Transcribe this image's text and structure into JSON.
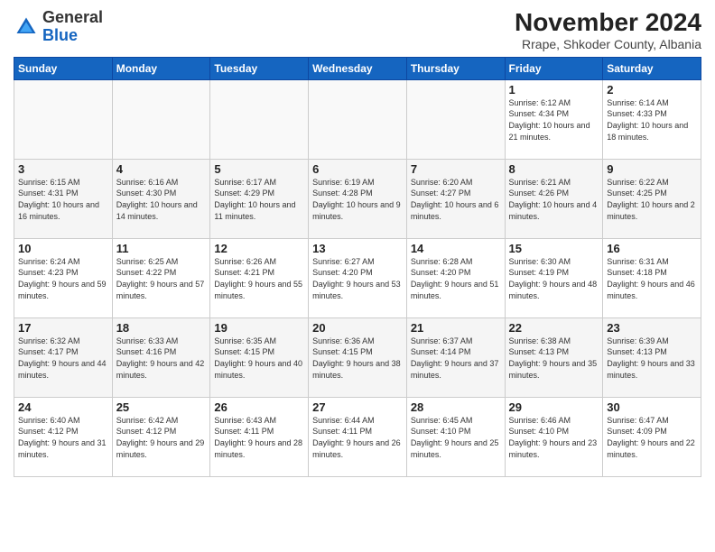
{
  "logo": {
    "general": "General",
    "blue": "Blue"
  },
  "title": {
    "month_year": "November 2024",
    "location": "Rrape, Shkoder County, Albania"
  },
  "weekdays": [
    "Sunday",
    "Monday",
    "Tuesday",
    "Wednesday",
    "Thursday",
    "Friday",
    "Saturday"
  ],
  "weeks": [
    [
      {
        "day": "",
        "info": ""
      },
      {
        "day": "",
        "info": ""
      },
      {
        "day": "",
        "info": ""
      },
      {
        "day": "",
        "info": ""
      },
      {
        "day": "",
        "info": ""
      },
      {
        "day": "1",
        "info": "Sunrise: 6:12 AM\nSunset: 4:34 PM\nDaylight: 10 hours and 21 minutes."
      },
      {
        "day": "2",
        "info": "Sunrise: 6:14 AM\nSunset: 4:33 PM\nDaylight: 10 hours and 18 minutes."
      }
    ],
    [
      {
        "day": "3",
        "info": "Sunrise: 6:15 AM\nSunset: 4:31 PM\nDaylight: 10 hours and 16 minutes."
      },
      {
        "day": "4",
        "info": "Sunrise: 6:16 AM\nSunset: 4:30 PM\nDaylight: 10 hours and 14 minutes."
      },
      {
        "day": "5",
        "info": "Sunrise: 6:17 AM\nSunset: 4:29 PM\nDaylight: 10 hours and 11 minutes."
      },
      {
        "day": "6",
        "info": "Sunrise: 6:19 AM\nSunset: 4:28 PM\nDaylight: 10 hours and 9 minutes."
      },
      {
        "day": "7",
        "info": "Sunrise: 6:20 AM\nSunset: 4:27 PM\nDaylight: 10 hours and 6 minutes."
      },
      {
        "day": "8",
        "info": "Sunrise: 6:21 AM\nSunset: 4:26 PM\nDaylight: 10 hours and 4 minutes."
      },
      {
        "day": "9",
        "info": "Sunrise: 6:22 AM\nSunset: 4:25 PM\nDaylight: 10 hours and 2 minutes."
      }
    ],
    [
      {
        "day": "10",
        "info": "Sunrise: 6:24 AM\nSunset: 4:23 PM\nDaylight: 9 hours and 59 minutes."
      },
      {
        "day": "11",
        "info": "Sunrise: 6:25 AM\nSunset: 4:22 PM\nDaylight: 9 hours and 57 minutes."
      },
      {
        "day": "12",
        "info": "Sunrise: 6:26 AM\nSunset: 4:21 PM\nDaylight: 9 hours and 55 minutes."
      },
      {
        "day": "13",
        "info": "Sunrise: 6:27 AM\nSunset: 4:20 PM\nDaylight: 9 hours and 53 minutes."
      },
      {
        "day": "14",
        "info": "Sunrise: 6:28 AM\nSunset: 4:20 PM\nDaylight: 9 hours and 51 minutes."
      },
      {
        "day": "15",
        "info": "Sunrise: 6:30 AM\nSunset: 4:19 PM\nDaylight: 9 hours and 48 minutes."
      },
      {
        "day": "16",
        "info": "Sunrise: 6:31 AM\nSunset: 4:18 PM\nDaylight: 9 hours and 46 minutes."
      }
    ],
    [
      {
        "day": "17",
        "info": "Sunrise: 6:32 AM\nSunset: 4:17 PM\nDaylight: 9 hours and 44 minutes."
      },
      {
        "day": "18",
        "info": "Sunrise: 6:33 AM\nSunset: 4:16 PM\nDaylight: 9 hours and 42 minutes."
      },
      {
        "day": "19",
        "info": "Sunrise: 6:35 AM\nSunset: 4:15 PM\nDaylight: 9 hours and 40 minutes."
      },
      {
        "day": "20",
        "info": "Sunrise: 6:36 AM\nSunset: 4:15 PM\nDaylight: 9 hours and 38 minutes."
      },
      {
        "day": "21",
        "info": "Sunrise: 6:37 AM\nSunset: 4:14 PM\nDaylight: 9 hours and 37 minutes."
      },
      {
        "day": "22",
        "info": "Sunrise: 6:38 AM\nSunset: 4:13 PM\nDaylight: 9 hours and 35 minutes."
      },
      {
        "day": "23",
        "info": "Sunrise: 6:39 AM\nSunset: 4:13 PM\nDaylight: 9 hours and 33 minutes."
      }
    ],
    [
      {
        "day": "24",
        "info": "Sunrise: 6:40 AM\nSunset: 4:12 PM\nDaylight: 9 hours and 31 minutes."
      },
      {
        "day": "25",
        "info": "Sunrise: 6:42 AM\nSunset: 4:12 PM\nDaylight: 9 hours and 29 minutes."
      },
      {
        "day": "26",
        "info": "Sunrise: 6:43 AM\nSunset: 4:11 PM\nDaylight: 9 hours and 28 minutes."
      },
      {
        "day": "27",
        "info": "Sunrise: 6:44 AM\nSunset: 4:11 PM\nDaylight: 9 hours and 26 minutes."
      },
      {
        "day": "28",
        "info": "Sunrise: 6:45 AM\nSunset: 4:10 PM\nDaylight: 9 hours and 25 minutes."
      },
      {
        "day": "29",
        "info": "Sunrise: 6:46 AM\nSunset: 4:10 PM\nDaylight: 9 hours and 23 minutes."
      },
      {
        "day": "30",
        "info": "Sunrise: 6:47 AM\nSunset: 4:09 PM\nDaylight: 9 hours and 22 minutes."
      }
    ]
  ]
}
